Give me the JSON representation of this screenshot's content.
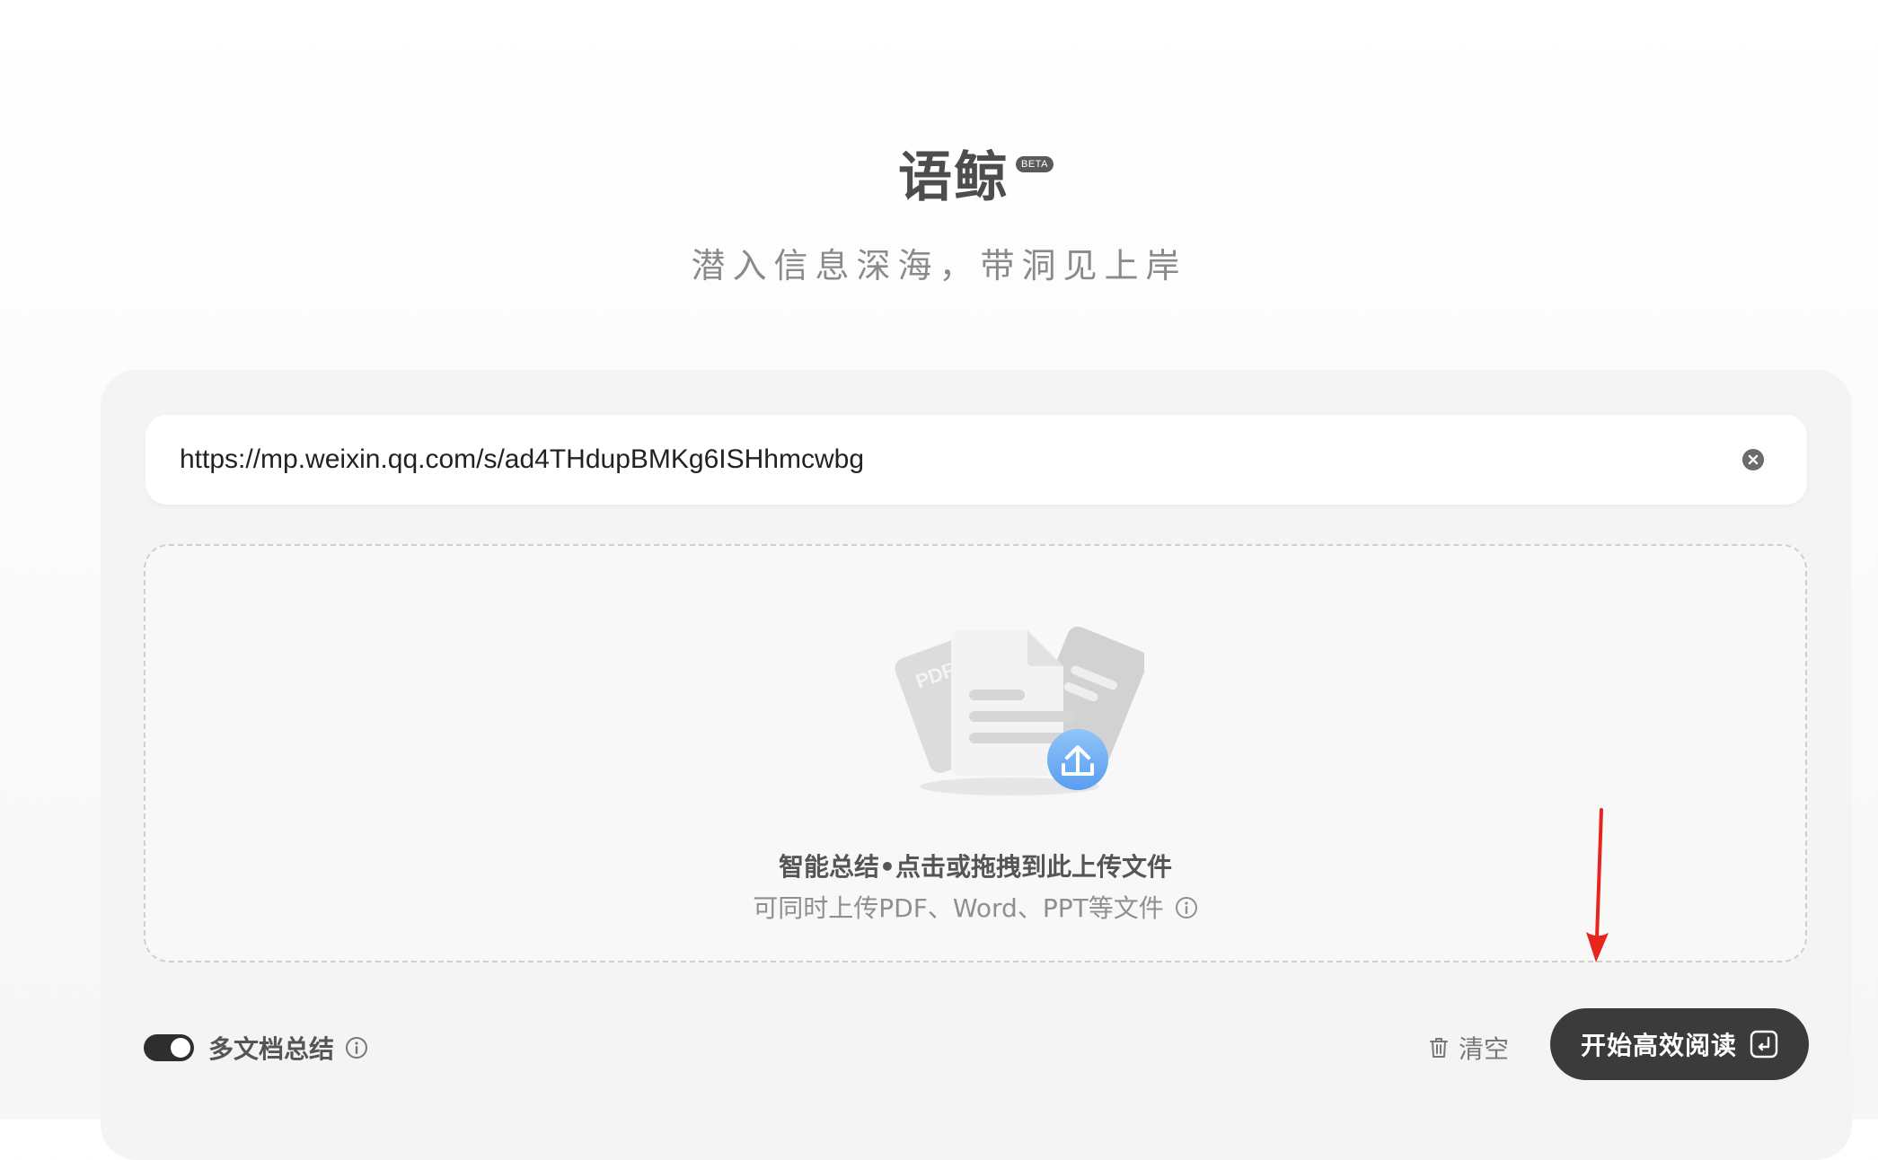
{
  "header": {
    "title": "语鲸",
    "badge": "BETA",
    "slogan": "潜入信息深海，带洞见上岸"
  },
  "url_input": {
    "value": "https://mp.weixin.qq.com/s/ad4THdupBMKg6ISHhmcwbg",
    "clear_icon": "close-circle-icon"
  },
  "upload": {
    "illustration_label": "PDF",
    "title": "智能总结•点击或拖拽到此上传文件",
    "subtitle": "可同时上传PDF、Word、PPT等文件",
    "info_icon": "info-circle-icon"
  },
  "controls": {
    "multi_doc_label": "多文档总结",
    "multi_doc_enabled": true,
    "clear_label": "清空",
    "clear_icon": "trash-icon",
    "start_label": "开始高效阅读",
    "start_icon": "enter-key-icon"
  },
  "colors": {
    "primary_button": "#3b3b3b",
    "annotation_arrow": "#e8241e",
    "upload_badge": "#6aaef5"
  }
}
